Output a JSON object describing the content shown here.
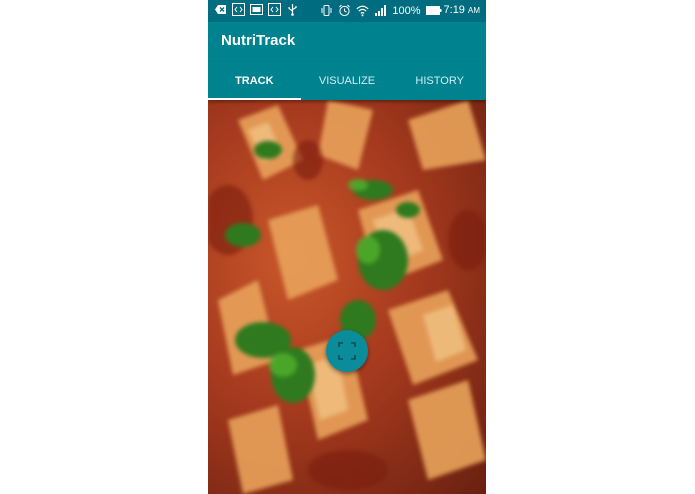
{
  "status_bar": {
    "battery_percent": "100%",
    "time": "7:19",
    "time_suffix": "AM",
    "icons": [
      "notification-icon",
      "code-icon",
      "image-icon",
      "code-icon",
      "usb-icon",
      "vibrate-icon",
      "alarm-icon",
      "wifi-icon",
      "signal-icon",
      "battery-icon"
    ]
  },
  "app_bar": {
    "title": "NutriTrack"
  },
  "tabs": [
    {
      "label": "TRACK",
      "active": true
    },
    {
      "label": "VISUALIZE",
      "active": false
    },
    {
      "label": "HISTORY",
      "active": false
    }
  ],
  "camera_view": {
    "content": "penne pasta with basil"
  },
  "fab": {
    "icon": "scan-frame-icon"
  },
  "colors": {
    "status_bar": "#006c7f",
    "primary": "#00838f",
    "fab": "#0b8c9a",
    "tab_indicator": "#ffffff"
  }
}
